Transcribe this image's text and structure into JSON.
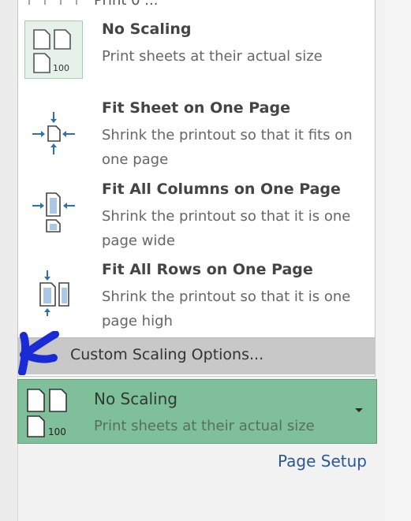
{
  "partial_item_label": "Print 0 ...",
  "options": [
    {
      "title": "No Scaling",
      "description": "Print sheets at their actual size",
      "selected": true,
      "icon": "no-scaling-icon"
    },
    {
      "title": "Fit Sheet on One Page",
      "description": "Shrink the printout so that it fits on one page",
      "selected": false,
      "icon": "fit-sheet-icon"
    },
    {
      "title": "Fit All Columns on One Page",
      "description": "Shrink the printout so that it is one page wide",
      "selected": false,
      "icon": "fit-columns-icon"
    },
    {
      "title": "Fit All Rows on One Page",
      "description": "Shrink the printout so that it is one page high",
      "selected": false,
      "icon": "fit-rows-icon"
    }
  ],
  "custom_scaling_label": "Custom Scaling Options...",
  "current_setting": {
    "title": "No Scaling",
    "description": "Print sheets at their actual size",
    "icon_number": "100"
  },
  "no_scaling_icon_number": "100",
  "page_setup_link": "Page Setup",
  "colors": {
    "selected_box": "#7fbf99",
    "highlight": "#c8c8c8",
    "annotation": "#1a2bd6",
    "link": "#2b5797"
  }
}
